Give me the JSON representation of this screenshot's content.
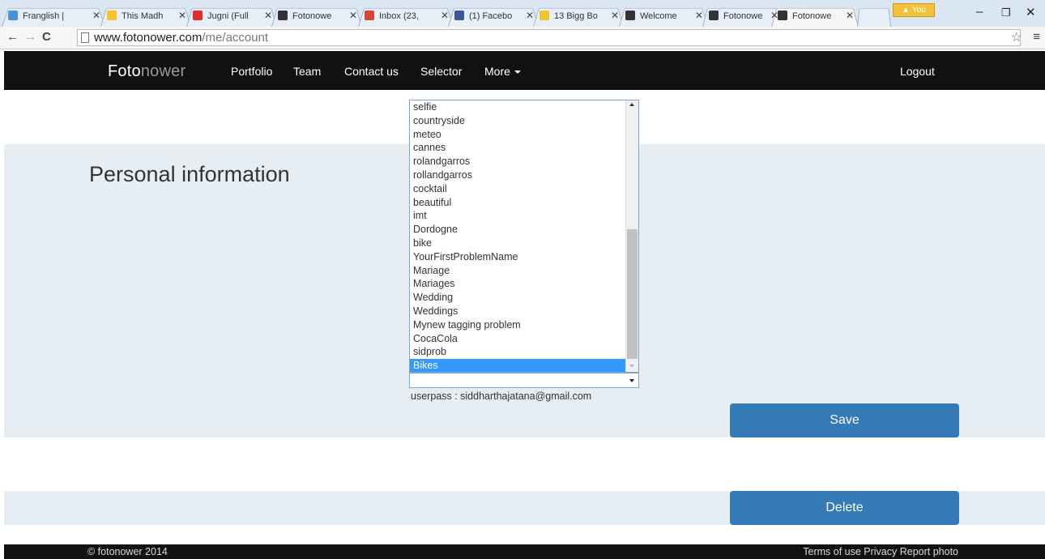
{
  "browser": {
    "tabs": [
      {
        "title": "Franglish |",
        "icon": "globe-icon",
        "color": "#4a90d9"
      },
      {
        "title": "This Madh",
        "icon": "sticky-note-icon",
        "color": "#f4c430"
      },
      {
        "title": "Jugni (Full",
        "icon": "youtube-icon",
        "color": "#e52d27"
      },
      {
        "title": "Fotonowe",
        "icon": "fotonower-icon",
        "color": "#333333"
      },
      {
        "title": "Inbox (23,",
        "icon": "gmail-icon",
        "color": "#d44638"
      },
      {
        "title": "(1) Facebo",
        "icon": "facebook-icon",
        "color": "#3b5998"
      },
      {
        "title": "13 Bigg Bo",
        "icon": "sticky-note-icon",
        "color": "#f4c430"
      },
      {
        "title": "Welcome",
        "icon": "fotonower-icon",
        "color": "#333333"
      },
      {
        "title": "Fotonowe",
        "icon": "fotonower-icon",
        "color": "#333333"
      },
      {
        "title": "Fotonowe",
        "icon": "fotonower-icon",
        "color": "#333333"
      }
    ],
    "profile_label": "You",
    "url_host": "www.fotonower.com",
    "url_path": "/me/account"
  },
  "nav": {
    "logo_bold": "Foto",
    "logo_light": "nower",
    "links": [
      "Portfolio",
      "Team",
      "Contact us",
      "Selector",
      "More"
    ],
    "logout": "Logout"
  },
  "main": {
    "section_title": "Personal information",
    "tags": [
      "selfie",
      "countryside",
      "meteo",
      "cannes",
      "rolandgarros",
      "rollandgarros",
      "cocktail",
      "beautiful",
      "imt",
      "Dordogne",
      "bike",
      "YourFirstProblemName",
      "Mariage",
      "Mariages",
      "Wedding",
      "Weddings",
      "Mynew tagging problem",
      "CocaCola",
      "sidprob",
      "Bikes"
    ],
    "selected_tag": "Bikes",
    "combo_value": "",
    "userpass": "userpass : siddharthajatana@gmail.com",
    "save_label": "Save",
    "delete_label": "Delete"
  },
  "footer": {
    "copyright": "© fotonower 2014",
    "links": "Terms of use Privacy Report photo"
  },
  "colors": {
    "accent": "#337ab7",
    "selection": "#3399ff",
    "navbar": "#111111",
    "section_bg": "#e7eef3"
  }
}
